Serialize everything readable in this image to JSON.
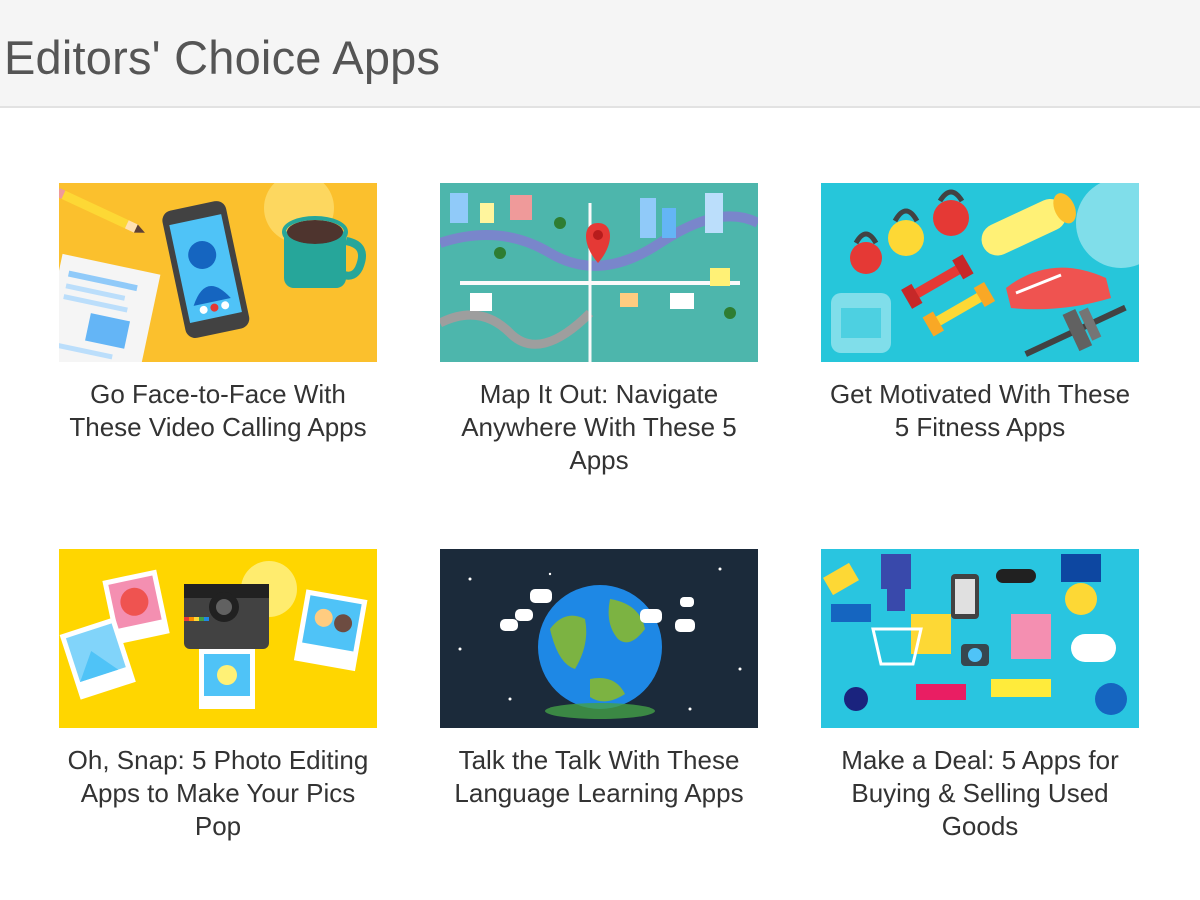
{
  "header": {
    "title": "Editors' Choice Apps"
  },
  "colors": {
    "header_bg": "#f5f5f5",
    "video_bg": "#fbc02d",
    "map_bg": "#4db6ac",
    "fitness_bg": "#26c6da",
    "photo_bg": "#ffd600",
    "language_bg": "#1b2a3a",
    "deals_bg": "#29c5e0"
  },
  "cards": [
    {
      "title": "Go Face-to-Face With These Video Calling Apps",
      "image": "video-calling-illustration"
    },
    {
      "title": "Map It Out: Navigate Anywhere With These 5 Apps",
      "image": "city-map-illustration"
    },
    {
      "title": "Get Motivated With These 5 Fitness Apps",
      "image": "fitness-equipment-illustration"
    },
    {
      "title": "Oh, Snap: 5 Photo Editing Apps to Make Your Pics Pop",
      "image": "instant-camera-illustration"
    },
    {
      "title": "Talk the Talk With These Language Learning Apps",
      "image": "globe-speech-illustration"
    },
    {
      "title": "Make a Deal: 5 Apps for Buying & Selling Used Goods",
      "image": "shopping-items-illustration"
    }
  ]
}
